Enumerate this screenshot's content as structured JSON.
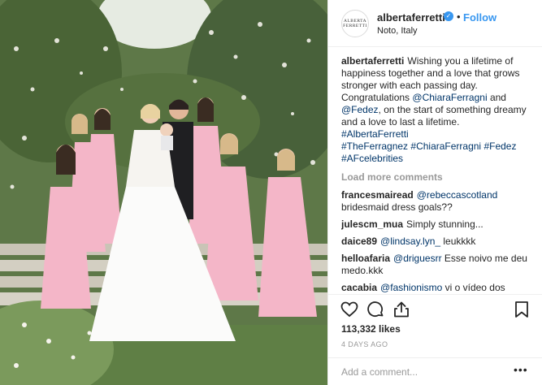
{
  "post": {
    "username": "albertaferretti",
    "location": "Noto, Italy",
    "follow_label": "Follow",
    "avatar_text_1": "ALBERTA",
    "avatar_text_2": "FERRETTI",
    "dot": "•"
  },
  "caption": {
    "username": "albertaferretti",
    "text_1": "Wishing you a lifetime of happiness together and a love that grows stronger with each passing day. Congratulations ",
    "mention_1": "@ChiaraFerragni",
    "text_2": " and ",
    "mention_2": "@Fedez",
    "text_3": ", on the start of something dreamy and a love to last a lifetime.",
    "hashtag_1": "#AlbertaFerretti",
    "hashtag_2": "#TheFerragnez",
    "hashtag_3": "#ChiaraFerragni",
    "hashtag_4": "#Fedez",
    "hashtag_5": "#AFcelebrities"
  },
  "load_more": "Load more comments",
  "comments": [
    {
      "user": "francesmairead",
      "mention": "@rebeccascotland",
      "text": " bridesmaid dress goals??"
    },
    {
      "user": "julescm_mua",
      "mention": "",
      "text": "Simply stunning..."
    },
    {
      "user": "daice89",
      "mention": "@lindsay.lyn_",
      "text": " leukkkk"
    },
    {
      "user": "helloafaria",
      "mention": "@driguesrr",
      "text": " Esse noivo me deu medo.kkk"
    },
    {
      "user": "cacabia",
      "mention": "@fashionismo",
      "text": " vi o vídeo dos dresses na vogue 😵◻"
    }
  ],
  "likes": "113,332 likes",
  "time": "4 DAYS AGO",
  "add_comment_placeholder": "Add a comment...",
  "more_label": "•••",
  "colors": {
    "accent": "#3897f0",
    "mention": "#003569",
    "muted": "#999999",
    "dress_pink": "#f4b6c8"
  }
}
